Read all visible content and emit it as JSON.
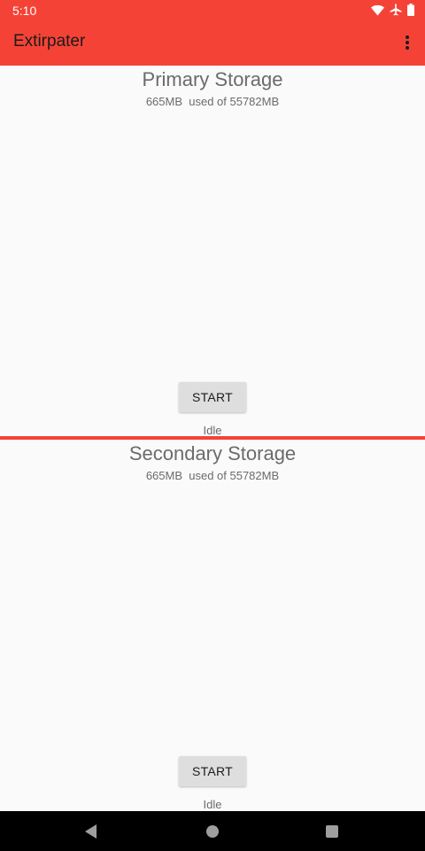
{
  "status_bar": {
    "time": "5:10",
    "icons": [
      "wifi-icon",
      "airplane-mode-icon",
      "battery-icon"
    ]
  },
  "app_bar": {
    "title": "Extirpater",
    "menu_icon": "overflow-menu-icon",
    "color": "#f44336"
  },
  "primary": {
    "title": "Primary Storage",
    "usage": "665MB  used of 55782MB",
    "button_label": "START",
    "status": "Idle"
  },
  "secondary": {
    "title": "Secondary Storage",
    "usage": "665MB  used of 55782MB",
    "button_label": "START",
    "status": "Idle"
  },
  "nav_bar": {
    "icons": [
      "back-icon",
      "home-icon",
      "recents-icon"
    ]
  }
}
